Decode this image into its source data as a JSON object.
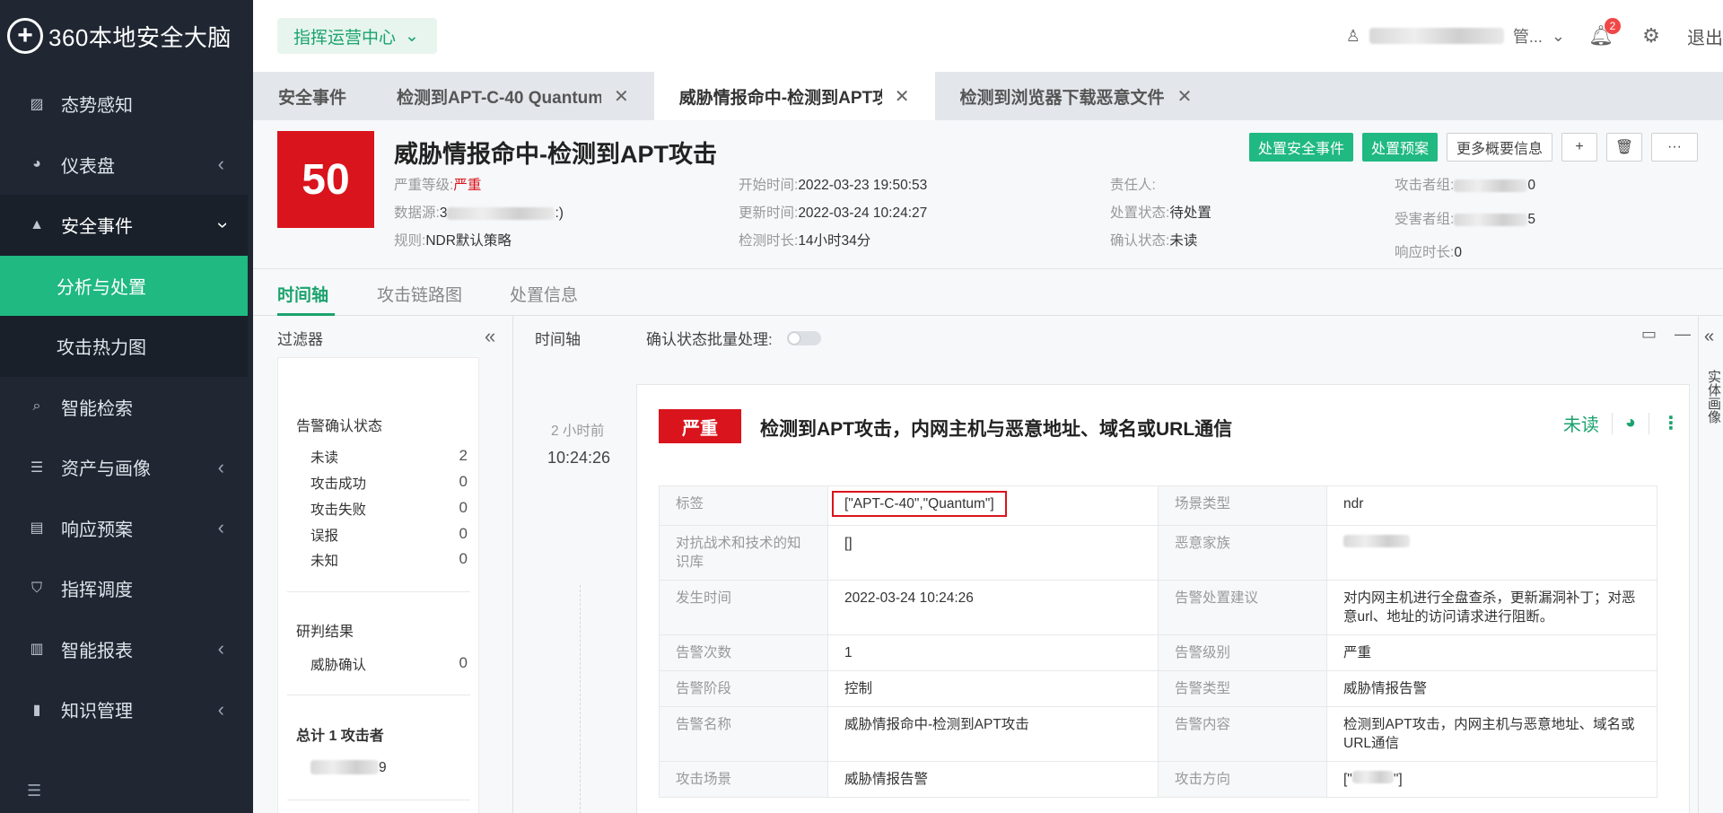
{
  "app": {
    "logo_mark": "+",
    "logo_text": "360本地安全大脑"
  },
  "sidebar": {
    "items": [
      {
        "label": "态势感知",
        "icon": "chart-icon"
      },
      {
        "label": "仪表盘",
        "icon": "dashboard-icon"
      },
      {
        "label": "安全事件",
        "icon": "warning-icon"
      },
      {
        "label": "分析与处置"
      },
      {
        "label": "攻击热力图"
      },
      {
        "label": "智能检索",
        "icon": "search-icon"
      },
      {
        "label": "资产与画像",
        "icon": "server-icon"
      },
      {
        "label": "响应预案",
        "icon": "document-icon"
      },
      {
        "label": "指挥调度",
        "icon": "shield-icon"
      },
      {
        "label": "智能报表",
        "icon": "report-icon"
      },
      {
        "label": "知识管理",
        "icon": "book-icon"
      }
    ],
    "collapse_icon": "menu-collapse-icon"
  },
  "topbar": {
    "center_select": "指挥运营中心",
    "user_suffix": "管...",
    "notification_count": "2",
    "logout": "退出"
  },
  "tabs": [
    {
      "label": "安全事件"
    },
    {
      "label": "检测到APT-C-40 Quantum",
      "closable": true
    },
    {
      "label": "威胁情报命中-检测到APT攻",
      "closable": true
    },
    {
      "label": "检测到浏览器下载恶意文件",
      "closable": true
    }
  ],
  "event": {
    "score": "50",
    "title": "威胁情报命中-检测到APT攻击",
    "severity_key": "严重等级:",
    "severity_val": "严重",
    "datasource_key": "数据源:",
    "datasource_val_pre": "3",
    "datasource_val_post": ":)",
    "rule_key": "规则:",
    "rule_val": "NDR默认策略",
    "start_key": "开始时间:",
    "start_val": "2022-03-23 19:50:53",
    "update_key": "更新时间:",
    "update_val": "2022-03-24 10:24:27",
    "duration_key": "检测时长:",
    "duration_val": "14小时34分",
    "owner_key": "责任人:",
    "owner_val": "",
    "handle_key": "处置状态:",
    "handle_val": "待处置",
    "confirm_key": "确认状态:",
    "confirm_val": "未读",
    "attacker_key": "攻击者组:",
    "attacker_val_tail": "0",
    "victim_key": "受害者组:",
    "victim_val_tail": "5",
    "response_key": "响应时长:",
    "response_val": "0",
    "actions": {
      "handle_event": "处置安全事件",
      "handle_plan": "处置预案",
      "more_info": "更多概要信息",
      "add": "+",
      "delete": "🗑",
      "more": "···"
    }
  },
  "subtabs": [
    "时间轴",
    "攻击链路图",
    "处置信息"
  ],
  "filter": {
    "title": "过滤器",
    "collapse": "«",
    "confirm_section": "告警确认状态",
    "confirm_rows": [
      {
        "label": "未读",
        "value": "2"
      },
      {
        "label": "攻击成功",
        "value": "0"
      },
      {
        "label": "攻击失败",
        "value": "0"
      },
      {
        "label": "误报",
        "value": "0"
      },
      {
        "label": "未知",
        "value": "0"
      }
    ],
    "judge_section": "研判结果",
    "judge_rows": [
      {
        "label": "威胁确认",
        "value": "0"
      }
    ],
    "total_pre": "总计 ",
    "total_num": "1",
    "total_post": " 攻击者",
    "attacker_tail": "9"
  },
  "timeline": {
    "title": "时间轴",
    "batch_label": "确认状态批量处理:",
    "ago": "2 小时前",
    "time": "10:24:26",
    "card": {
      "severity": "严重",
      "title": "检测到APT攻击，内网主机与恶意地址、域名或URL通信",
      "status": "未读",
      "rows": [
        {
          "k1": "标签",
          "v1": "[\"APT-C-40\",\"Quantum\"]",
          "k2": "场景类型",
          "v2": "ndr"
        },
        {
          "k1": "对抗战术和技术的知识库",
          "v1": "[]",
          "k2": "恶意家族",
          "v2": ""
        },
        {
          "k1": "发生时间",
          "v1": "2022-03-24 10:24:26",
          "k2": "告警处置建议",
          "v2": "对内网主机进行全盘查杀，更新漏洞补丁；对恶意url、地址的访问请求进行阻断。"
        },
        {
          "k1": "告警次数",
          "v1": "1",
          "k2": "告警级别",
          "v2": "严重"
        },
        {
          "k1": "告警阶段",
          "v1": "控制",
          "k2": "告警类型",
          "v2": "威胁情报告警"
        },
        {
          "k1": "告警名称",
          "v1": "威胁情报命中-检测到APT攻击",
          "k2": "告警内容",
          "v2": "检测到APT攻击，内网主机与恶意地址、域名或URL通信"
        },
        {
          "k1": "攻击场景",
          "v1": "威胁情报告警",
          "k2": "攻击方向",
          "v2": "[\""
        }
      ],
      "attack_dir_tail": "\"]"
    }
  },
  "right_strip": {
    "label": "实体画像"
  },
  "colors": {
    "brand_green": "#1fb981",
    "severity_red": "#d9141c",
    "sidebar_bg": "#202733"
  }
}
